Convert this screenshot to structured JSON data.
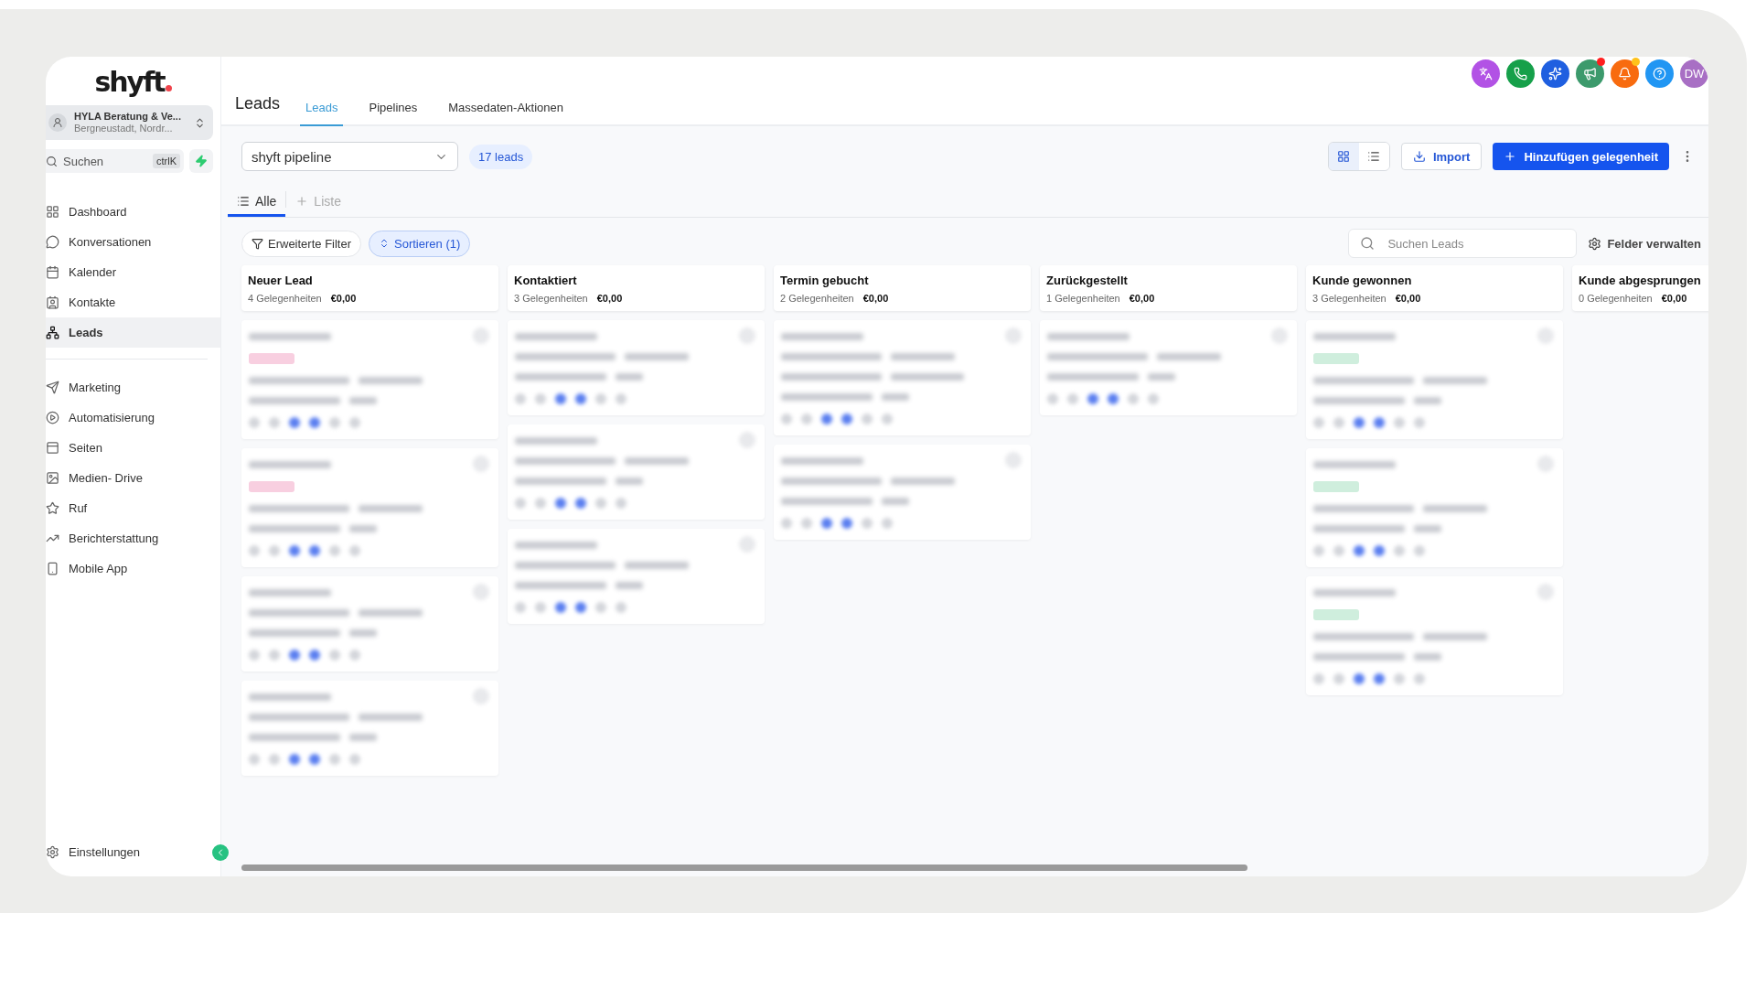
{
  "sidebar": {
    "logo": "shyft",
    "account": {
      "name": "HYLA Beratung & Ve...",
      "location": "Bergneustadt, Nordr..."
    },
    "search": {
      "placeholder": "Suchen",
      "shortcut": "ctrlK"
    },
    "items": [
      {
        "label": "Dashboard",
        "selected": false
      },
      {
        "label": "Konversationen",
        "selected": false
      },
      {
        "label": "Kalender",
        "selected": false
      },
      {
        "label": "Kontakte",
        "selected": false
      },
      {
        "label": "Leads",
        "selected": true
      }
    ],
    "items_2": [
      {
        "label": "Marketing",
        "selected": false
      },
      {
        "label": "Automatisierung",
        "selected": false
      },
      {
        "label": "Seiten",
        "selected": false
      },
      {
        "label": "Medien- Drive",
        "selected": false
      },
      {
        "label": "Ruf",
        "selected": false
      },
      {
        "label": "Berichterstattung",
        "selected": false
      },
      {
        "label": "Mobile App",
        "selected": false
      }
    ],
    "settings": "Einstellungen"
  },
  "header": {
    "title": "Leads",
    "tabs": [
      {
        "label": "Leads",
        "selected": true
      },
      {
        "label": "Pipelines",
        "selected": false
      },
      {
        "label": "Massedaten-Aktionen",
        "selected": false
      }
    ],
    "avatar": "DW",
    "notification_dots": [
      {
        "color": "#ff1f1f"
      },
      {
        "color": "#ffc21a"
      }
    ]
  },
  "toolbar": {
    "pipeline": "shyft pipeline",
    "count": "17 leads",
    "views": [
      {
        "kind": "grid",
        "selected": true
      },
      {
        "kind": "list",
        "selected": false
      }
    ],
    "import": "Import",
    "add": "Hinzufügen gelegenheit"
  },
  "list_tabs": [
    {
      "label": "Alle",
      "selected": true
    },
    {
      "label": "Liste",
      "selected": false
    }
  ],
  "filters": {
    "filter": "Erweiterte Filter",
    "sort": "Sortieren (1)",
    "search_placeholder": "Suchen Leads",
    "fields": "Felder verwalten"
  },
  "columns": [
    {
      "title": "Neuer Lead",
      "count": "4 Gelegenheiten",
      "value": "€0,00",
      "cards": [
        {
          "kind": "tagged",
          "color": "#f8cfe0"
        },
        {
          "kind": "tagged",
          "color": "#f8cfe0"
        },
        {
          "kind": "plain"
        },
        {
          "kind": "plain"
        }
      ]
    },
    {
      "title": "Kontaktiert",
      "count": "3 Gelegenheiten",
      "value": "€0,00",
      "cards": [
        {
          "kind": "plain"
        },
        {
          "kind": "plain"
        },
        {
          "kind": "plain"
        }
      ]
    },
    {
      "title": "Termin gebucht",
      "count": "2 Gelegenheiten",
      "value": "€0,00",
      "cards": [
        {
          "kind": "plain3"
        },
        {
          "kind": "plain"
        }
      ]
    },
    {
      "title": "Zurückgestellt",
      "count": "1 Gelegenheiten",
      "value": "€0,00",
      "cards": [
        {
          "kind": "plain"
        }
      ]
    },
    {
      "title": "Kunde gewonnen",
      "count": "3 Gelegenheiten",
      "value": "€0,00",
      "cards": [
        {
          "kind": "tagged",
          "color": "#cfeedd"
        },
        {
          "kind": "tagged",
          "color": "#cfeedd"
        },
        {
          "kind": "tagged",
          "color": "#cfeedd"
        }
      ]
    },
    {
      "title": "Kunde abgesprungen",
      "count": "0 Gelegenheiten",
      "value": "€0,00"
    }
  ]
}
